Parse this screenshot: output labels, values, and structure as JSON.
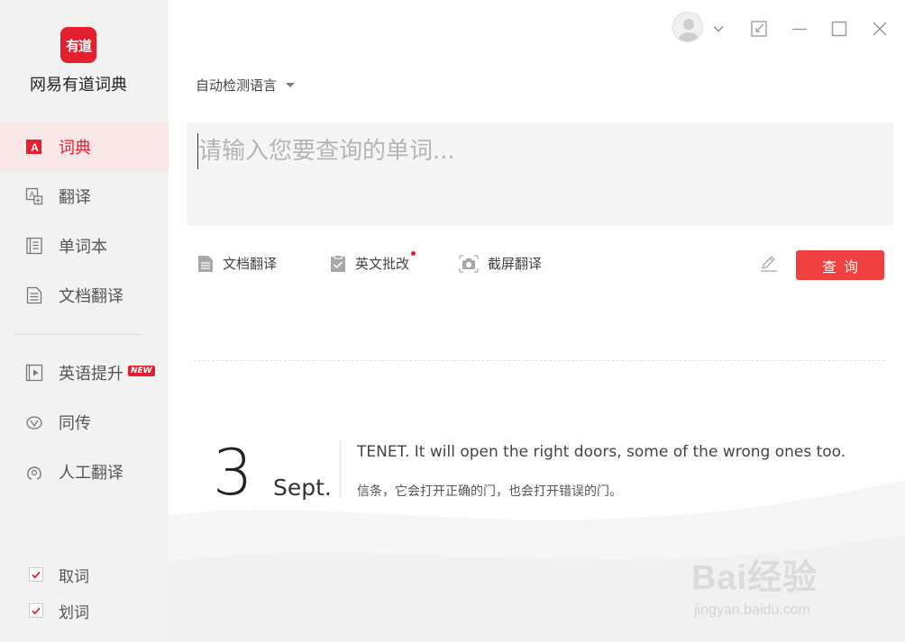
{
  "app": {
    "logo_text": "有道",
    "name": "网易有道词典"
  },
  "sidebar": {
    "items": [
      {
        "label": "词典",
        "active": true
      },
      {
        "label": "翻译"
      },
      {
        "label": "单词本"
      },
      {
        "label": "文档翻译"
      },
      {
        "label": "英语提升",
        "badge": "NEW"
      },
      {
        "label": "同传"
      },
      {
        "label": "人工翻译"
      }
    ],
    "checks": [
      {
        "label": "取词",
        "checked": true
      },
      {
        "label": "划词",
        "checked": true
      }
    ]
  },
  "main": {
    "lang_select": "自动检测语言",
    "query_placeholder": "请输入您要查询的单词...",
    "tools": [
      {
        "label": "文档翻译"
      },
      {
        "label": "英文批改",
        "dot": true
      },
      {
        "label": "截屏翻译"
      }
    ],
    "search_label": "查询"
  },
  "daily": {
    "day": "3",
    "month": "Sept.",
    "quote_en": "TENET. It will open the right doors, some of the wrong ones too.",
    "quote_zh": "信条，它会打开正确的门，也会打开错误的门。"
  },
  "watermark": {
    "brand": "Bai经验",
    "url": "jingyan.baidu.com"
  },
  "colors": {
    "accent": "#e5202e",
    "button": "#ef3f3f",
    "sidebar_bg": "#f2f2f2",
    "active_bg": "#f9e6e6"
  }
}
